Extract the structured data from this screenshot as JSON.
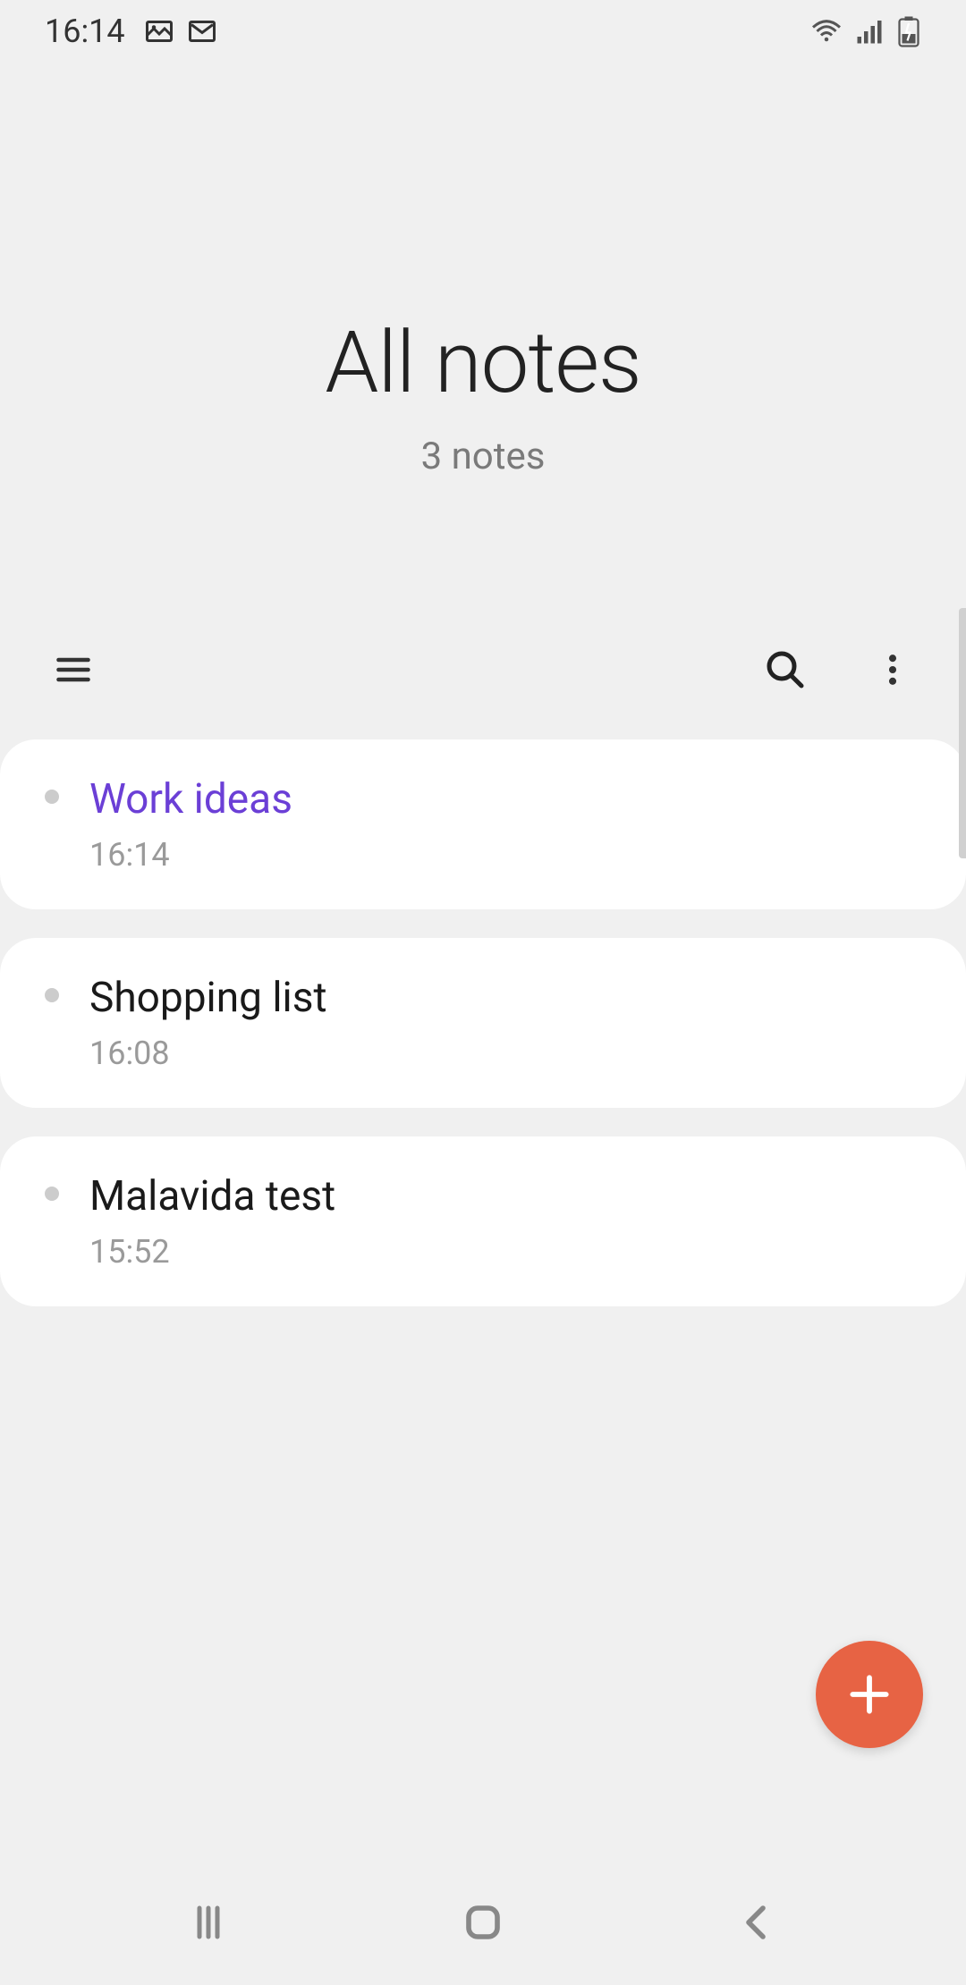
{
  "statusBar": {
    "time": "16:14"
  },
  "header": {
    "title": "All notes",
    "subtitle": "3 notes"
  },
  "notes": [
    {
      "title": "Work ideas",
      "time": "16:14",
      "highlighted": true
    },
    {
      "title": "Shopping list",
      "time": "16:08",
      "highlighted": false
    },
    {
      "title": "Malavida test",
      "time": "15:52",
      "highlighted": false
    }
  ]
}
